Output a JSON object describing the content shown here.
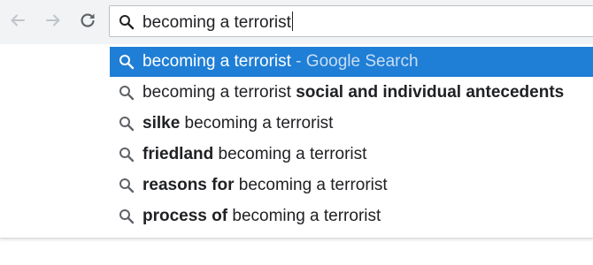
{
  "omnibox": {
    "value": "becoming a terrorist"
  },
  "icons": {
    "back": "arrow-left-icon",
    "forward": "arrow-right-icon",
    "reload": "reload-icon",
    "search": "search-icon"
  },
  "colors": {
    "selected_background": "#1f7ed6",
    "toolbar_background": "#f1f3f4"
  },
  "suggestions": [
    {
      "prefix": "",
      "main": "becoming a terrorist",
      "suffix": "",
      "hint": " - Google Search"
    },
    {
      "prefix": "",
      "main": "becoming a terrorist ",
      "suffix": "social and individual antecedents",
      "hint": ""
    },
    {
      "prefix": "silke ",
      "main": "becoming a terrorist",
      "suffix": "",
      "hint": ""
    },
    {
      "prefix": "friedland ",
      "main": "becoming a terrorist",
      "suffix": "",
      "hint": ""
    },
    {
      "prefix": "reasons for ",
      "main": "becoming a terrorist",
      "suffix": "",
      "hint": ""
    },
    {
      "prefix": "process of ",
      "main": "becoming a terrorist",
      "suffix": "",
      "hint": ""
    }
  ]
}
